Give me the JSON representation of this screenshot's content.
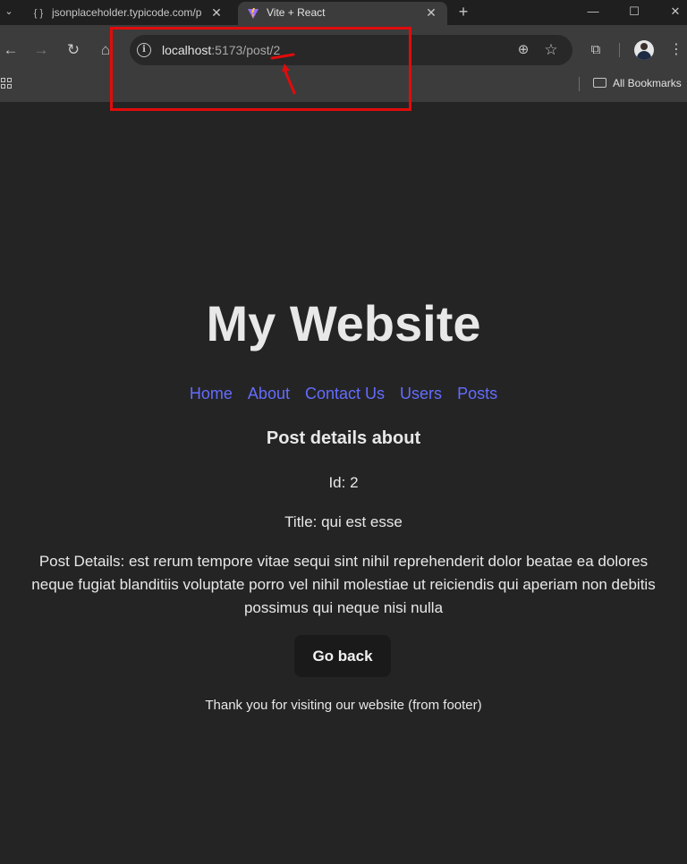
{
  "browser": {
    "tabs": [
      {
        "title": "jsonplaceholder.typicode.com/p",
        "favicon": "json-favicon-icon",
        "active": false
      },
      {
        "title": "Vite + React",
        "favicon": "vite-logo-icon",
        "active": true
      }
    ],
    "new_tab": "+",
    "address": {
      "host": "localhost",
      "path": ":5173/post/2"
    },
    "bookmarks": {
      "all_label": "All Bookmarks"
    },
    "icons": [
      "tab-search-icon",
      "back-icon",
      "forward-icon",
      "reload-icon",
      "home-icon",
      "site-info-icon",
      "zoom-icon",
      "bookmark-star-icon",
      "extensions-icon",
      "profile-avatar-icon",
      "menu-icon",
      "apps-icon",
      "folder-icon",
      "minimize-icon",
      "maximize-icon",
      "close-window-icon"
    ]
  },
  "annotation": {
    "color": "#e10b0b"
  },
  "page": {
    "site_title": "My Website",
    "nav": [
      {
        "label": "Home"
      },
      {
        "label": "About"
      },
      {
        "label": "Contact Us"
      },
      {
        "label": "Users"
      },
      {
        "label": "Posts"
      }
    ],
    "heading": "Post details about",
    "id_line": "Id: 2",
    "title_line": "Title: qui est esse",
    "details_line": "Post Details: est rerum tempore vitae sequi sint nihil reprehenderit dolor beatae ea dolores neque fugiat blanditiis voluptate porro vel nihil molestiae ut reiciendis qui aperiam non debitis possimus qui neque nisi nulla",
    "back_button": "Go back",
    "footer": "Thank you for visiting our website (from footer)"
  },
  "colors": {
    "background": "#242424",
    "link": "#646cff",
    "button_bg": "#1a1a1a",
    "text": "#e8e8e8"
  }
}
